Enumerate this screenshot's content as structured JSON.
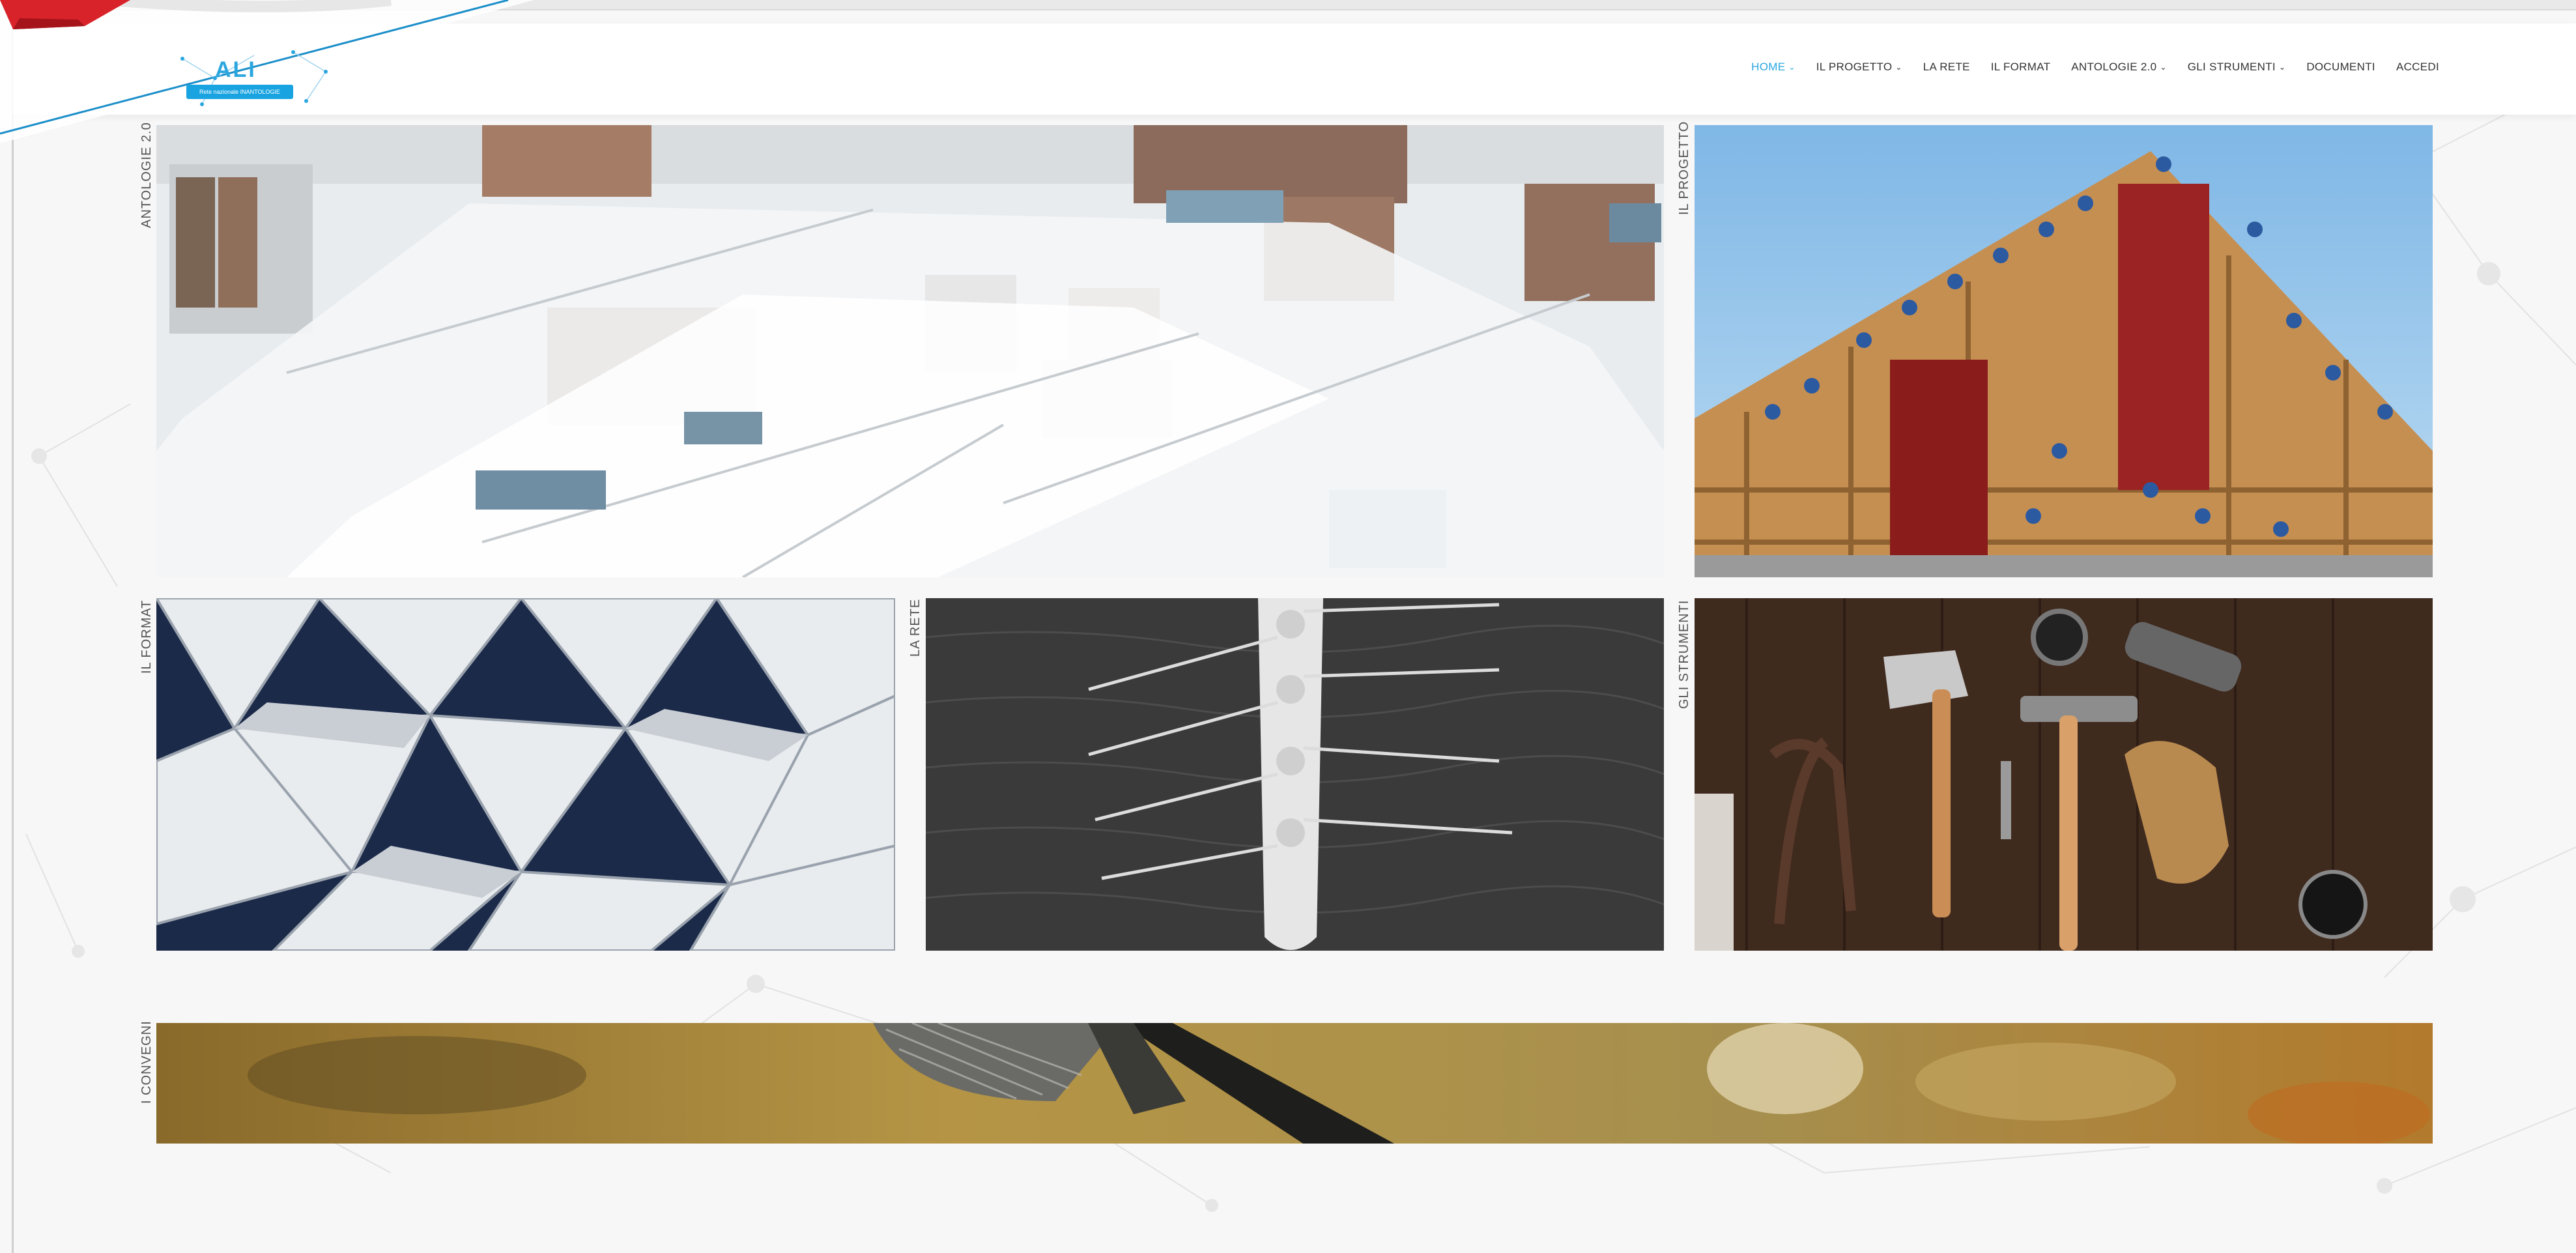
{
  "header": {
    "logo_text": "ALI",
    "logo_tagline": "Rete nazionale INANTOLOGIE",
    "nav": [
      {
        "label": "HOME",
        "active": true,
        "has_dropdown": true
      },
      {
        "label": "IL PROGETTO",
        "active": false,
        "has_dropdown": true
      },
      {
        "label": "LA RETE",
        "active": false,
        "has_dropdown": false
      },
      {
        "label": "IL FORMAT",
        "active": false,
        "has_dropdown": false
      },
      {
        "label": "ANTOLOGIE 2.0",
        "active": false,
        "has_dropdown": true
      },
      {
        "label": "GLI STRUMENTI",
        "active": false,
        "has_dropdown": true
      },
      {
        "label": "DOCUMENTI",
        "active": false,
        "has_dropdown": false
      },
      {
        "label": "ACCEDI",
        "active": false,
        "has_dropdown": false
      }
    ]
  },
  "tiles": {
    "antologie": {
      "label": "ANTOLOGIE 2.0",
      "image": "library-interior"
    },
    "progetto": {
      "label": "IL PROGETTO",
      "image": "barn-construction"
    },
    "format": {
      "label": "IL FORMAT",
      "image": "geometric-lattice"
    },
    "rete": {
      "label": "LA RETE",
      "image": "rowing-boat"
    },
    "strumenti": {
      "label": "GLI STRUMENTI",
      "image": "tools-on-wood"
    },
    "convegni": {
      "label": "I CONVEGNI",
      "image": "microphone"
    }
  },
  "colors": {
    "accent": "#2aa6df",
    "ribbon_red": "#d9232a",
    "nav_text": "#333333"
  }
}
